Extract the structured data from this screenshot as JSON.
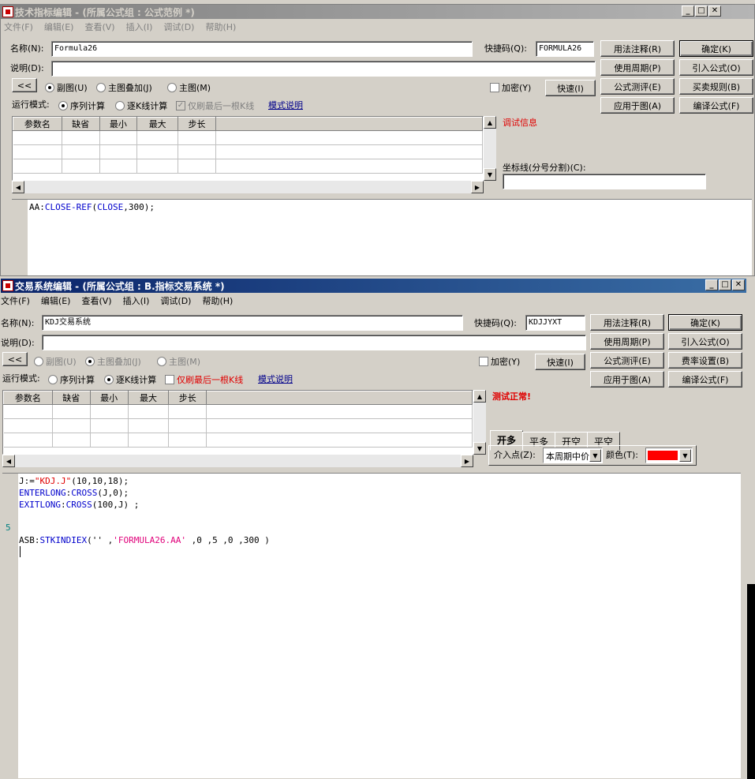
{
  "win1": {
    "title": "技术指标编辑 - (所属公式组 : 公式范例 *)",
    "menu": [
      "文件(F)",
      "编辑(E)",
      "查看(V)",
      "插入(I)",
      "调试(D)",
      "帮助(H)"
    ],
    "name_label": "名称(N):",
    "name_value": "Formula26",
    "shortcut_label": "快捷码(Q):",
    "shortcut_value": "FORMULA26",
    "desc_label": "说明(D):",
    "desc_value": "",
    "collapse_btn": "<<",
    "radio_sub": "副图(U)",
    "radio_overlay": "主图叠加(J)",
    "radio_main": "主图(M)",
    "encrypt_label": "加密(Y)",
    "quick_btn": "快速(I)",
    "buttons": {
      "usage_note": "用法注释(R)",
      "ok": "确定(K)",
      "period": "使用周期(P)",
      "import": "引入公式(O)",
      "test": "公式测评(E)",
      "trade_rule": "买卖规则(B)",
      "apply": "应用于图(A)",
      "compile": "编译公式(F)"
    },
    "run_mode_label": "运行模式:",
    "run_seq": "序列计算",
    "run_bar": "逐K线计算",
    "refresh_last": "仅刷最后一根K线",
    "mode_link": "模式说明",
    "grid_headers": [
      "参数名",
      "缺省",
      "最小",
      "最大",
      "步长"
    ],
    "debug_info": "调试信息",
    "coord_label": "坐标线(分号分割)(C):",
    "coord_value": "",
    "code": {
      "line1_prefix": "AA:",
      "kw_close_ref": "CLOSE-REF",
      "paren_open": "(",
      "kw_close": "CLOSE",
      "rest": ",300);"
    }
  },
  "win2": {
    "title": "交易系统编辑 - (所属公式组 : B.指标交易系统 *)",
    "menu": [
      "文件(F)",
      "编辑(E)",
      "查看(V)",
      "插入(I)",
      "调试(D)",
      "帮助(H)"
    ],
    "name_label": "名称(N):",
    "name_value": "KDJ交易系统",
    "shortcut_label": "快捷码(Q):",
    "shortcut_value": "KDJJYXT",
    "desc_label": "说明(D):",
    "desc_value": "",
    "collapse_btn": "<<",
    "radio_sub": "副图(U)",
    "radio_overlay": "主图叠加(J)",
    "radio_main": "主图(M)",
    "encrypt_label": "加密(Y)",
    "quick_btn": "快速(I)",
    "buttons": {
      "usage_note": "用法注释(R)",
      "ok": "确定(K)",
      "period": "使用周期(P)",
      "import": "引入公式(O)",
      "test": "公式测评(E)",
      "fee": "费率设置(B)",
      "apply": "应用于图(A)",
      "compile": "编译公式(F)"
    },
    "run_mode_label": "运行模式:",
    "run_seq": "序列计算",
    "run_bar": "逐K线计算",
    "refresh_last": "仅刷最后一根K线",
    "mode_link": "模式说明",
    "grid_headers": [
      "参数名",
      "缺省",
      "最小",
      "最大",
      "步长"
    ],
    "test_status": "测试正常!",
    "tabs": [
      "开多",
      "平多",
      "开空",
      "平空"
    ],
    "entry_label": "介入点(Z):",
    "entry_value": "本周期中价",
    "color_label": "颜色(T):",
    "color_value": "#ff0000",
    "gutter_marker": "5",
    "code": {
      "l1_a": "J:=",
      "l1_str": "\"KDJ.J\"",
      "l1_b": "(10,10,18);",
      "l2_kw": "ENTERLONG",
      "l2_a": ":",
      "l2_kw2": "CROSS",
      "l2_b": "(J,0);",
      "l3_kw": "EXITLONG",
      "l3_a": ":",
      "l3_kw2": "CROSS",
      "l3_b": "(100,J) ;",
      "l5_a": "ASB:",
      "l5_kw": "STKINDIEX",
      "l5_b": "('' ,",
      "l5_str": "'FORMULA26.AA'",
      "l5_c": " ,0 ,5 ,0 ,300 )"
    }
  }
}
